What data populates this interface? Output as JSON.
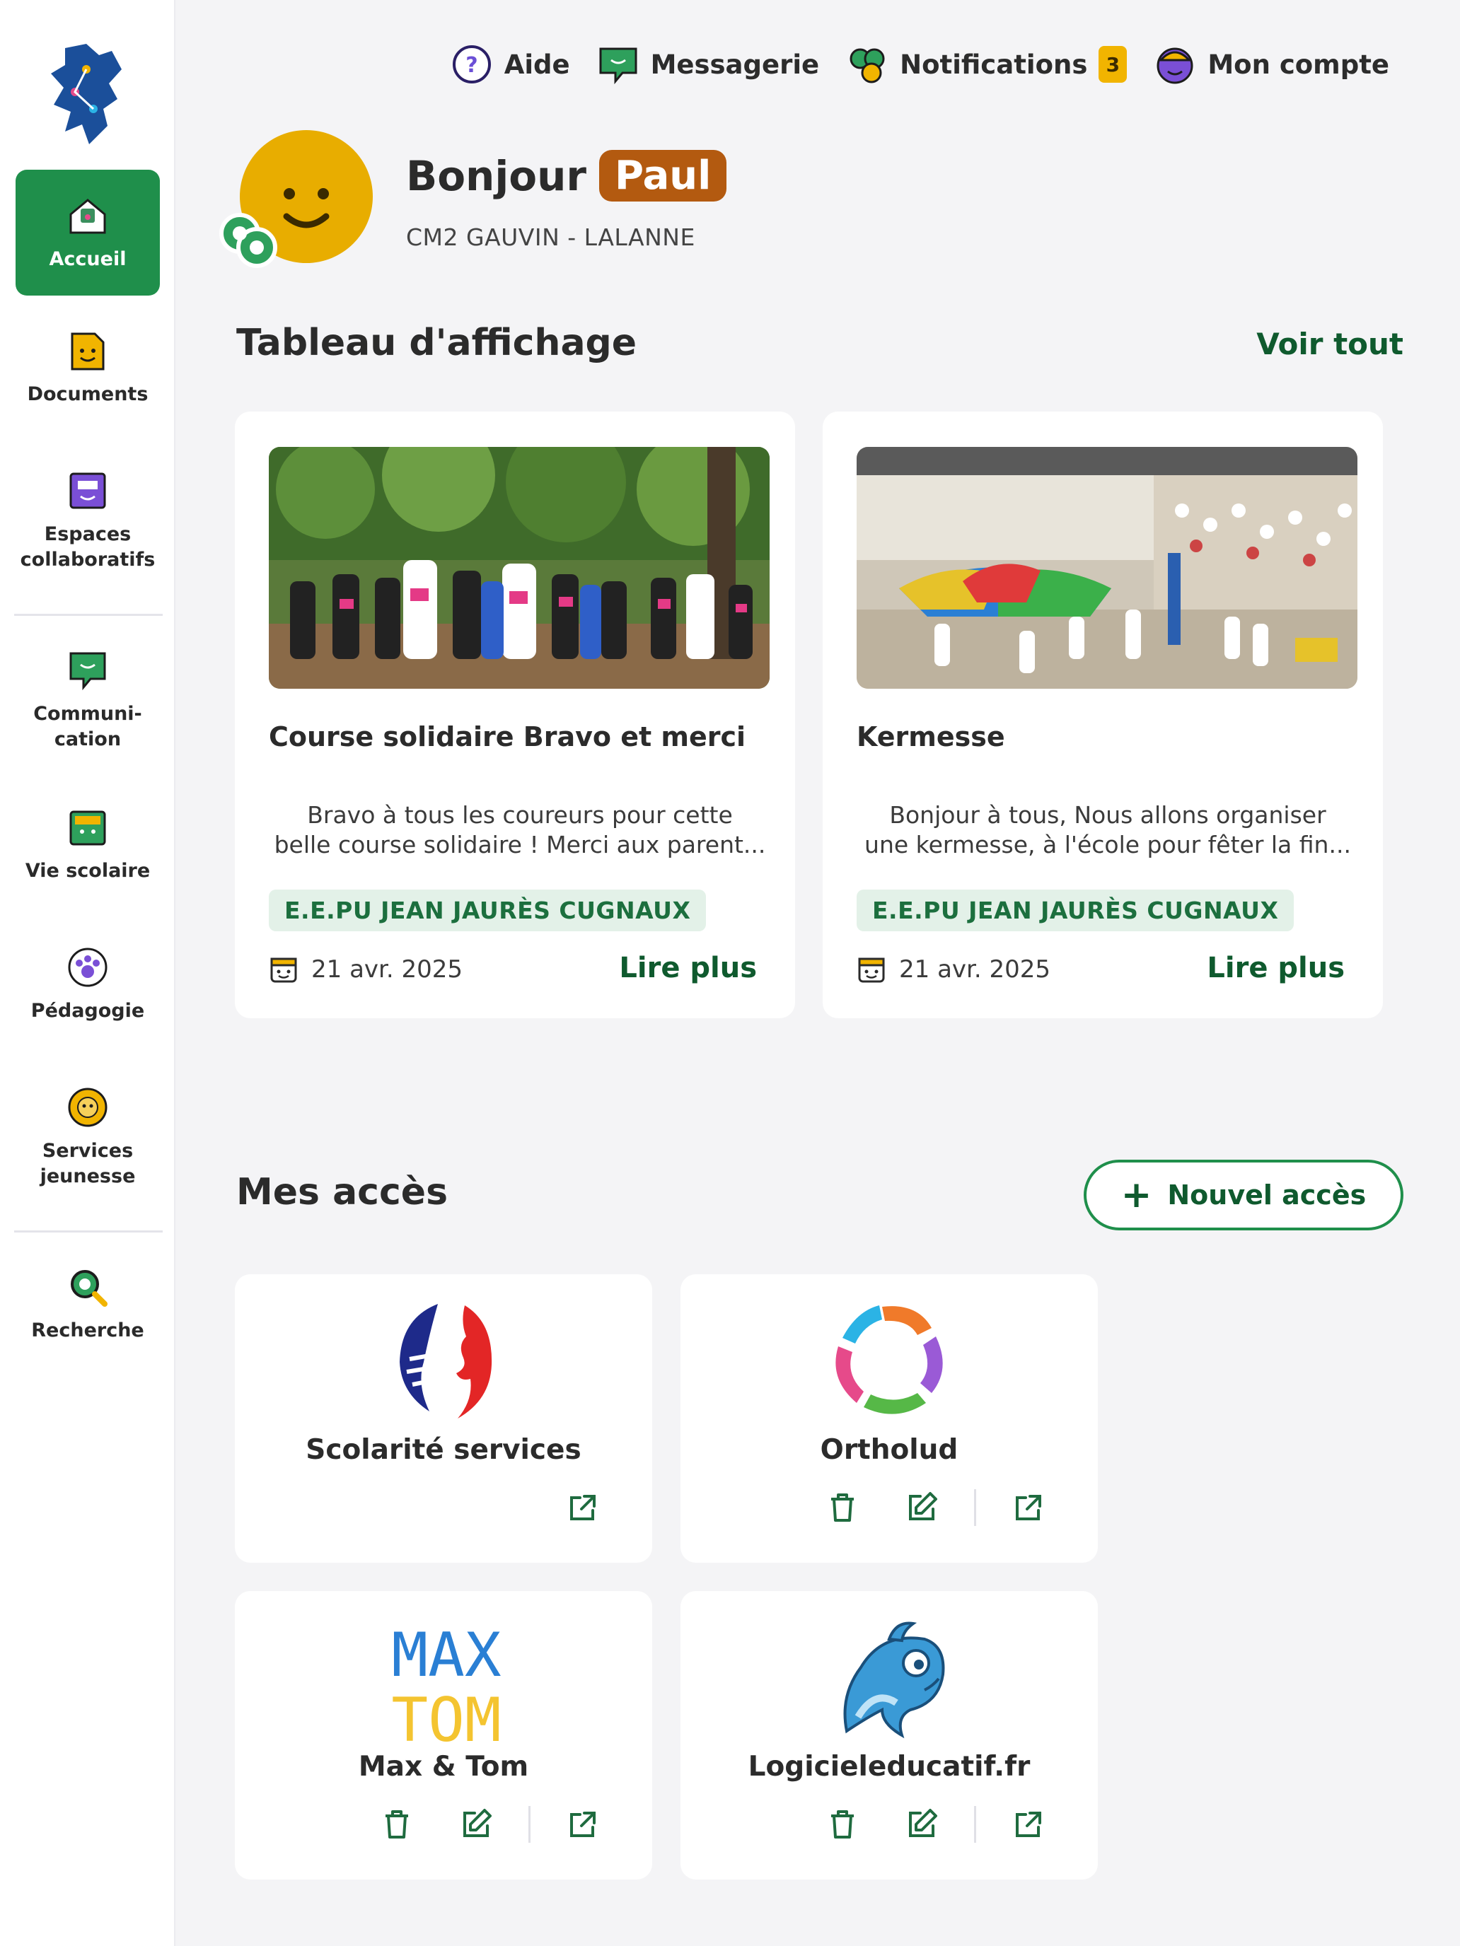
{
  "nav": {
    "items": [
      {
        "label": "Accueil",
        "icon": "home-icon"
      },
      {
        "label": "Documents",
        "icon": "documents-icon"
      },
      {
        "label": "Espaces\ncollaboratifs",
        "icon": "collab-spaces-icon"
      },
      {
        "label": "Communi-\ncation",
        "icon": "communication-icon"
      },
      {
        "label": "Vie scolaire",
        "icon": "school-life-icon"
      },
      {
        "label": "Pédagogie",
        "icon": "pedagogy-icon"
      },
      {
        "label": "Services\njeunesse",
        "icon": "youth-services-icon"
      },
      {
        "label": "Recherche",
        "icon": "search-icon"
      }
    ]
  },
  "topbar": {
    "help": "Aide",
    "messages": "Messagerie",
    "notifications": "Notifications",
    "notifications_count": "3",
    "account": "Mon compte"
  },
  "greeting": {
    "hello": "Bonjour",
    "name": "Paul",
    "class": "CM2 GAUVIN - LALANNE"
  },
  "board": {
    "title": "Tableau d'affichage",
    "see_all": "Voir tout",
    "cards": [
      {
        "title": "Course solidaire Bravo et merci",
        "excerpt_line1": "Bravo à tous les coureurs pour cette",
        "excerpt_line2": "belle course solidaire ! Merci aux parent...",
        "tag": "E.E.PU JEAN JAURÈS CUGNAUX",
        "date": "21 avr. 2025",
        "read_more": "Lire plus"
      },
      {
        "title": "Kermesse",
        "excerpt_line1": "Bonjour à tous,   Nous allons organiser",
        "excerpt_line2": "une kermesse, à l'école pour fêter la fin...",
        "tag": "E.E.PU JEAN JAURÈS CUGNAUX",
        "date": "21 avr. 2025",
        "read_more": "Lire plus"
      }
    ]
  },
  "access": {
    "title": "Mes accès",
    "new_access": "Nouvel accès",
    "apps": [
      {
        "name": "Scolarité services",
        "logo": "marianne-logo"
      },
      {
        "name": "Ortholud",
        "logo": "ortholud-logo"
      },
      {
        "name": "Max & Tom",
        "logo": "maxtom-logo",
        "logo_text_1": "MAX",
        "logo_text_2": "TOM"
      },
      {
        "name": "Logicieleducatif.fr",
        "logo": "dolphin-logo"
      }
    ]
  },
  "colors": {
    "accent": "#1f8f4b",
    "accent_dark": "#0f5a2e",
    "name_badge": "#b35a10",
    "notif_badge": "#f1b400",
    "tag_bg": "#e3f1e8"
  }
}
